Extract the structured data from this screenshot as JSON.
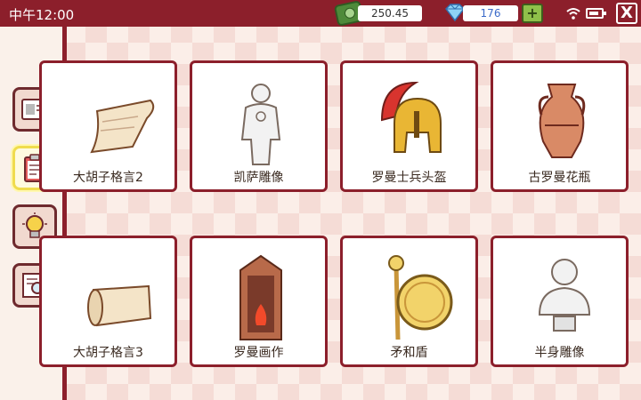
{
  "status_bar": {
    "time": "中午12:00"
  },
  "currency": {
    "money": "250.45",
    "gems": "176",
    "add_label": "+"
  },
  "window": {
    "close_label": "X"
  },
  "sidebar": {
    "items": [
      {
        "name": "id-card",
        "active": false
      },
      {
        "name": "clipboard",
        "active": true
      },
      {
        "name": "lightbulb",
        "active": false
      },
      {
        "name": "magnifier-notepad",
        "active": false
      }
    ]
  },
  "items": [
    {
      "label": "大胡子格言2",
      "icon": "paper-note-icon"
    },
    {
      "label": "凯萨雕像",
      "icon": "caesar-statue-icon"
    },
    {
      "label": "罗曼士兵头盔",
      "icon": "roman-helmet-icon"
    },
    {
      "label": "古罗曼花瓶",
      "icon": "roman-vase-icon"
    },
    {
      "label": "大胡子格言3",
      "icon": "scroll-icon"
    },
    {
      "label": "罗曼画作",
      "icon": "roman-painting-icon"
    },
    {
      "label": "矛和盾",
      "icon": "spear-shield-icon"
    },
    {
      "label": "半身雕像",
      "icon": "bust-statue-icon"
    }
  ]
}
